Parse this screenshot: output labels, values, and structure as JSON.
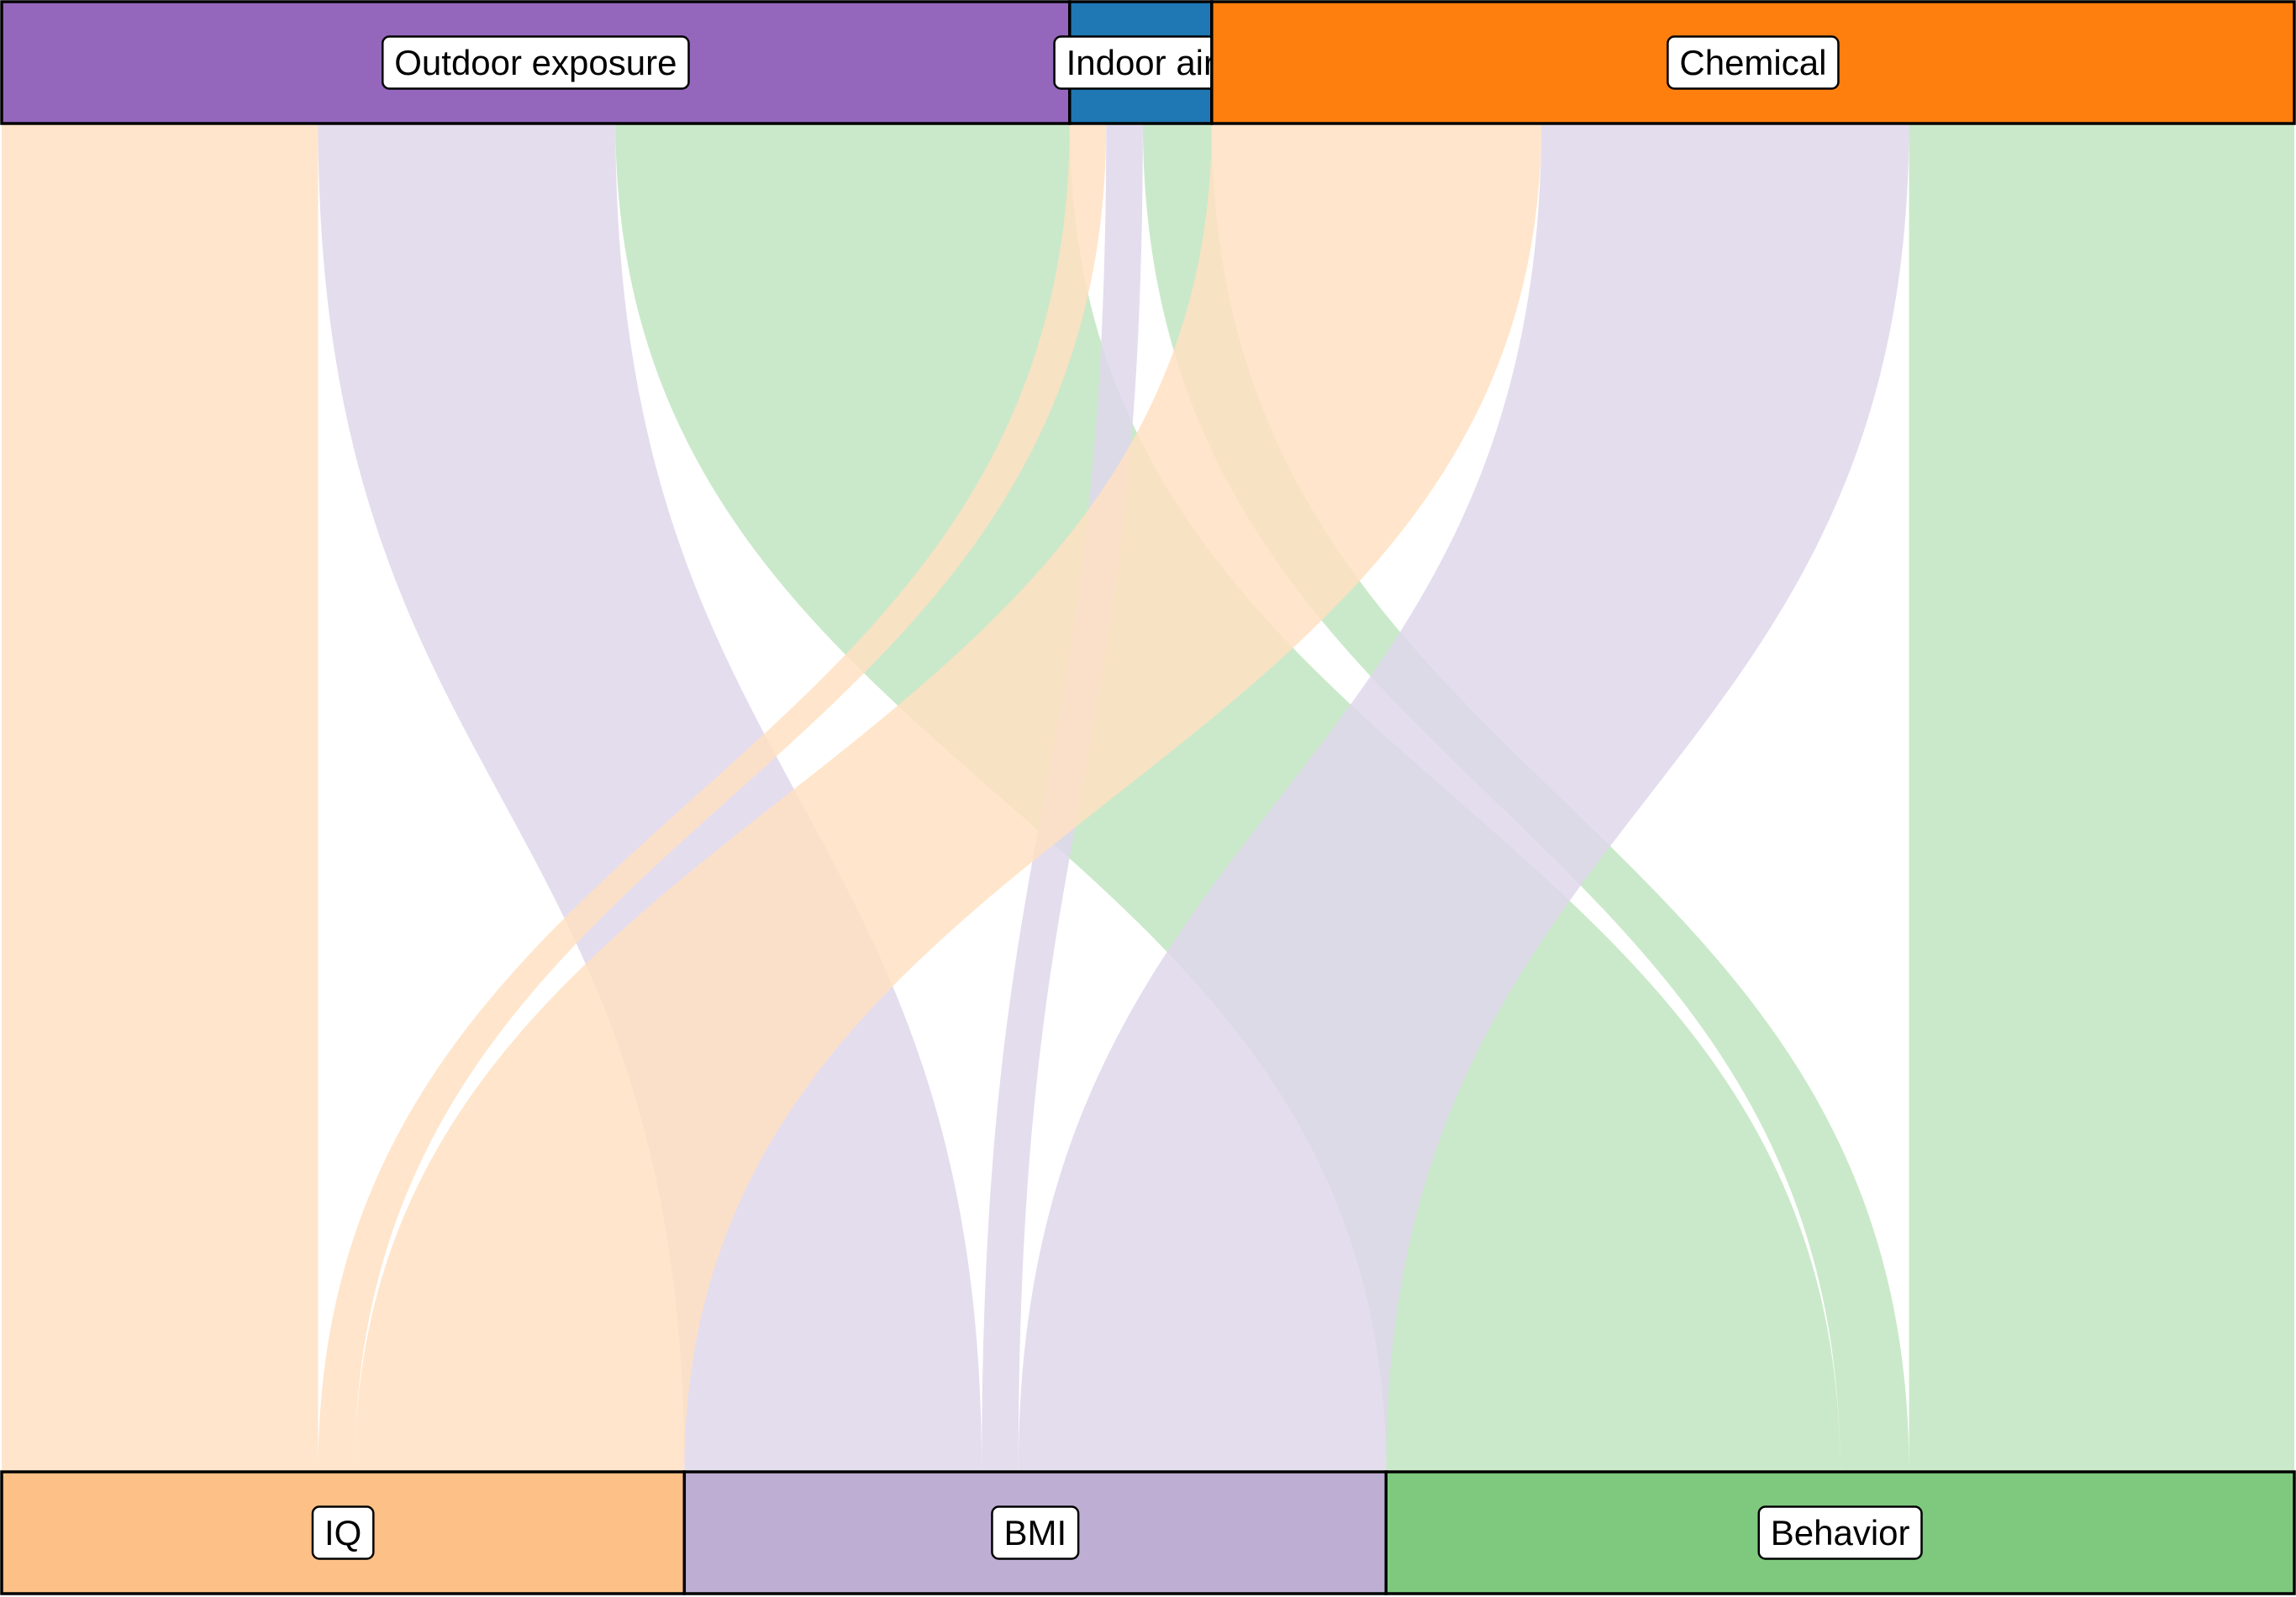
{
  "chart_data": {
    "type": "alluvial",
    "top_axis": [
      "Outdoor exposure",
      "Indoor air",
      "Chemical"
    ],
    "bottom_axis": [
      "IQ",
      "BMI",
      "Behavior"
    ],
    "node_colors": {
      "Outdoor exposure": "#9467bd",
      "Indoor air": "#1f77b4",
      "Chemical": "#ff7f0e",
      "IQ": "#fdc086",
      "BMI": "#beaed4",
      "Behavior": "#7fc97f"
    },
    "flow_colors": {
      "IQ": "#ffe0c2",
      "BMI": "#dfd7eb",
      "Behavior": "#c1e5c1"
    },
    "flows": [
      {
        "from": "Outdoor exposure",
        "to": "IQ",
        "value": 216
      },
      {
        "from": "Outdoor exposure",
        "to": "BMI",
        "value": 203
      },
      {
        "from": "Outdoor exposure",
        "to": "Behavior",
        "value": 310
      },
      {
        "from": "Indoor air",
        "to": "IQ",
        "value": 25
      },
      {
        "from": "Indoor air",
        "to": "BMI",
        "value": 25
      },
      {
        "from": "Indoor air",
        "to": "Behavior",
        "value": 47
      },
      {
        "from": "Chemical",
        "to": "IQ",
        "value": 225
      },
      {
        "from": "Chemical",
        "to": "BMI",
        "value": 251
      },
      {
        "from": "Chemical",
        "to": "Behavior",
        "value": 263
      }
    ]
  }
}
